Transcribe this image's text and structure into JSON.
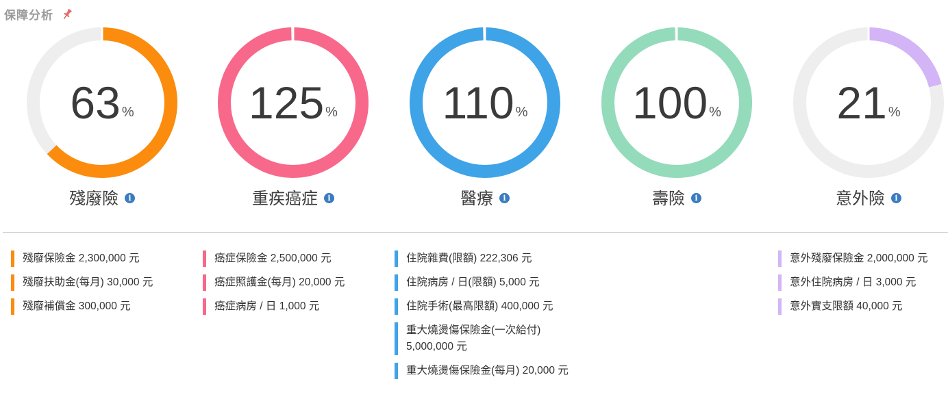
{
  "header": {
    "title": "保障分析",
    "pin_icon": "pin-icon"
  },
  "gauges": [
    {
      "id": "disability",
      "value": "63",
      "percent": 63,
      "unit": "%",
      "label": "殘廢險",
      "color": "#FB8C0D"
    },
    {
      "id": "critical",
      "value": "125",
      "percent": 125,
      "unit": "%",
      "label": "重疾癌症",
      "color": "#F8688A"
    },
    {
      "id": "medical",
      "value": "110",
      "percent": 110,
      "unit": "%",
      "label": "醫療",
      "color": "#3FA3E7"
    },
    {
      "id": "life",
      "value": "100",
      "percent": 100,
      "unit": "%",
      "label": "壽險",
      "color": "#93DBBB"
    },
    {
      "id": "accident",
      "value": "21",
      "percent": 21,
      "unit": "%",
      "label": "意外險",
      "color": "#D3B5F7"
    }
  ],
  "track_color": "#EEEEEE",
  "details": {
    "disability": [
      "殘廢保險金 2,300,000 元",
      "殘廢扶助金(每月) 30,000 元",
      "殘廢補償金 300,000 元"
    ],
    "critical": [
      "癌症保險金 2,500,000 元",
      "癌症照護金(每月) 20,000 元",
      "癌症病房 / 日 1,000 元"
    ],
    "medical": [
      "住院雜費(限額) 222,306 元",
      "住院病房 / 日(限額) 5,000 元",
      "住院手術(最高限額) 400,000 元",
      "重大燒燙傷保險金(一次給付) 5,000,000 元",
      "重大燒燙傷保險金(每月) 20,000 元"
    ],
    "accident": [
      "意外殘廢保險金 2,000,000 元",
      "意外住院病房 / 日 3,000 元",
      "意外實支限額 40,000 元"
    ]
  }
}
